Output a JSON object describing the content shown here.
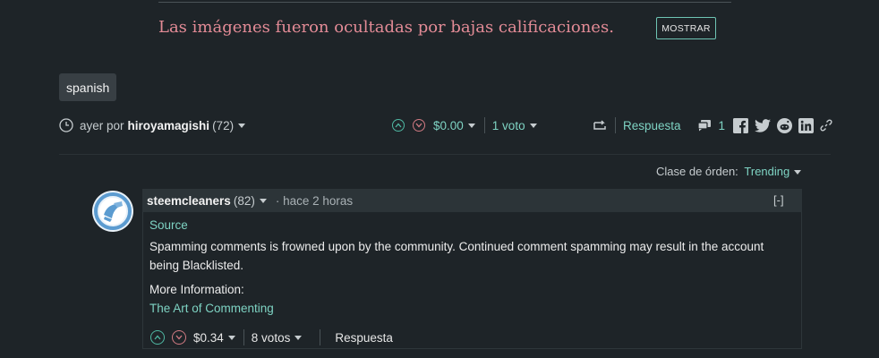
{
  "hidden_notice": {
    "message": "Las imágenes fueron ocultadas por bajas calificaciones.",
    "show_button": "MOSTRAR"
  },
  "tag": "spanish",
  "post_meta": {
    "time": "ayer por",
    "author": "hiroyamagishi",
    "reputation": "(72)",
    "payout": "$0.00",
    "votes": "1 voto",
    "reply": "Respuesta",
    "comment_count": "1"
  },
  "sort": {
    "label": "Clase de órden:",
    "value": "Trending"
  },
  "comment": {
    "author": "steemcleaners",
    "reputation": "(82)",
    "time": "· hace 2 horas",
    "collapse": "[-]",
    "source_link": "Source",
    "body": "Spamming comments is frowned upon by the community. Continued comment spamming may result in the account being Blacklisted.",
    "more_info": "More Information:",
    "info_link": "The Art of Commenting",
    "payout": "$0.34",
    "votes": "8 votos",
    "reply": "Respuesta"
  },
  "colors": {
    "background": "#1e2428",
    "accent": "#7ed3c3",
    "notice": "#e38b96",
    "downvote": "#d07a82"
  },
  "icons": [
    "clock-icon",
    "upvote-icon",
    "downvote-icon",
    "resteem-icon",
    "comments-icon",
    "facebook-icon",
    "twitter-icon",
    "reddit-icon",
    "linkedin-icon",
    "link-icon"
  ]
}
